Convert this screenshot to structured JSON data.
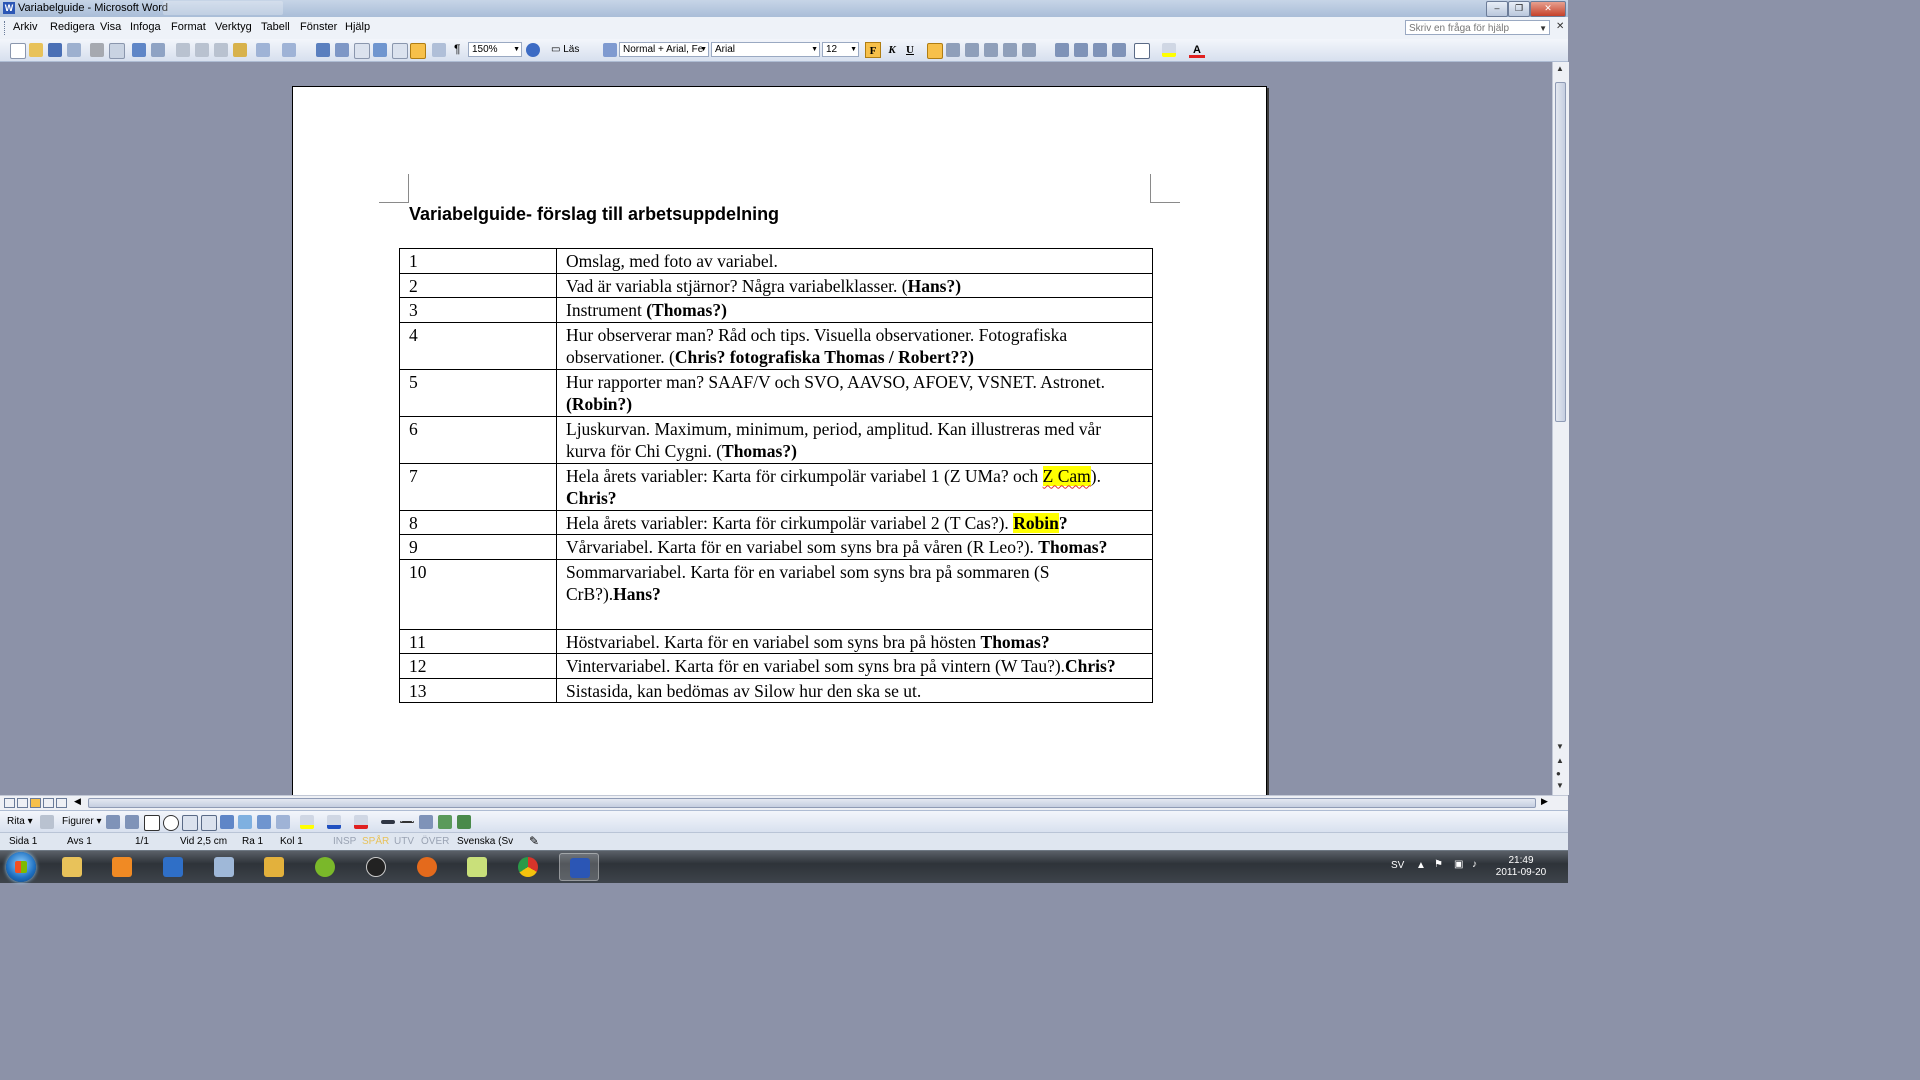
{
  "window": {
    "title": "Variabelguide - Microsoft Word",
    "minimize": "–",
    "restore": "❐",
    "close": "✕"
  },
  "menu": {
    "items": [
      "Arkiv",
      "Redigera",
      "Visa",
      "Infoga",
      "Format",
      "Verktyg",
      "Tabell",
      "Fönster",
      "Hjälp"
    ],
    "help_placeholder": "Skriv en fråga för hjälp",
    "doc_close": "✕"
  },
  "toolbar": {
    "zoom": "150%",
    "read_label": "Läs",
    "style": "Normal + Arial, Fe",
    "font": "Arial",
    "size": "12",
    "bold": "F",
    "italic": "K",
    "underline": "U",
    "pilcrow": "¶",
    "font_color_letter": "A"
  },
  "document": {
    "heading": "Variabelguide- förslag till arbetsuppdelning",
    "rows": [
      {
        "num": "1",
        "text": "Omslag, med foto av variabel."
      },
      {
        "num": "2",
        "text": "Vad är variabla stjärnor? Några variabelklasser. (",
        "bold": "Hans?)"
      },
      {
        "num": "3",
        "text": "Instrument ",
        "bold": "(Thomas?)"
      },
      {
        "num": "4",
        "text": "Hur observerar man? Råd och tips. Visuella observationer. Fotografiska observationer. (",
        "bold": "Chris? fotografiska Thomas / Robert??)"
      },
      {
        "num": "5",
        "text": "Hur rapporter man? SAAF/V och SVO, AAVSO, AFOEV, VSNET. Astronet.  ",
        "bold": "(Robin?)"
      },
      {
        "num": "6",
        "text": "Ljuskurvan. Maximum, minimum, period, amplitud. Kan illustreras med vår kurva för Chi Cygni. (",
        "bold": "Thomas?)"
      },
      {
        "num": "7",
        "text": "Hela årets variabler: Karta för cirkumpolär variabel 1 (Z UMa? och ",
        "highlight": "Z Cam",
        "text_after": "). ",
        "bold": "Chris?"
      },
      {
        "num": "8",
        "text": "Hela årets variabler: Karta för cirkumpolär variabel 2 (T Cas?). ",
        "bold_highlight": "Robin",
        "bold": "?"
      },
      {
        "num": "9",
        "text": "Vårvariabel. Karta för en variabel som syns bra på våren (R Leo?). ",
        "bold": "Thomas?"
      },
      {
        "num": "10",
        "text": "Sommarvariabel. Karta för en variabel som syns bra på sommaren (S CrB?).",
        "bold": "Hans?"
      },
      {
        "num": "11",
        "text": "Höstvariabel. Karta för en variabel som syns bra på hösten ",
        "bold": "Thomas?"
      },
      {
        "num": "12",
        "text": "Vintervariabel. Karta för en variabel som syns bra på vintern (W Tau?).",
        "bold": "Chris?"
      },
      {
        "num": "13",
        "text": "Sistasida, kan bedömas av Silow hur den ska se ut."
      }
    ]
  },
  "drawing": {
    "draw_label": "Rita",
    "shapes_label": "Figurer"
  },
  "status": {
    "page": "Sida 1",
    "section": "Avs 1",
    "pages": "1/1",
    "at": "Vid 2,5 cm",
    "line": "Ra 1",
    "col": "Kol 1",
    "insp": "INSP",
    "spar": "SPÅR",
    "utv": "UTV",
    "over": "ÖVER",
    "language": "Svenska (Sv"
  },
  "taskbar": {
    "lang": "SV",
    "time": "21:49",
    "date": "2011-09-20"
  },
  "colors": {
    "highlight": "#ffff00",
    "workspace": "#8c92a8",
    "word_blue": "#2b56b5"
  }
}
